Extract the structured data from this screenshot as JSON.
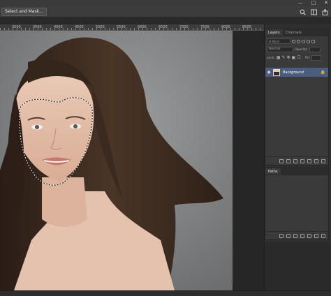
{
  "options_bar": {
    "select_mask_label": "Select and Mask...",
    "right_icons": [
      "search-icon",
      "workspace-icon",
      "share-icon"
    ]
  },
  "window_controls": [
    "minimize-icon",
    "restore-icon",
    "close-icon"
  ],
  "ruler": {
    "labels": [
      "3000",
      "3500",
      "4000",
      "4500",
      "5000",
      "5500",
      "6000",
      "6500",
      "7000",
      "7500",
      "8000",
      "8500"
    ]
  },
  "layers_panel": {
    "tabs": [
      "Layers",
      "Channels"
    ],
    "kind_filter": "Kind",
    "blend_mode": "Normal",
    "opacity_label": "Opacity:",
    "lock_label": "Lock:",
    "fill_label": "Fill:",
    "layer": {
      "name": "Background",
      "visible": true,
      "locked": true
    }
  },
  "paths_panel": {
    "tabs": [
      "Paths"
    ]
  },
  "colors": {
    "selected_layer": "#4a5d7e",
    "canvas_bg": "#7a7b7c",
    "ui_dark": "#2b2b2b"
  }
}
